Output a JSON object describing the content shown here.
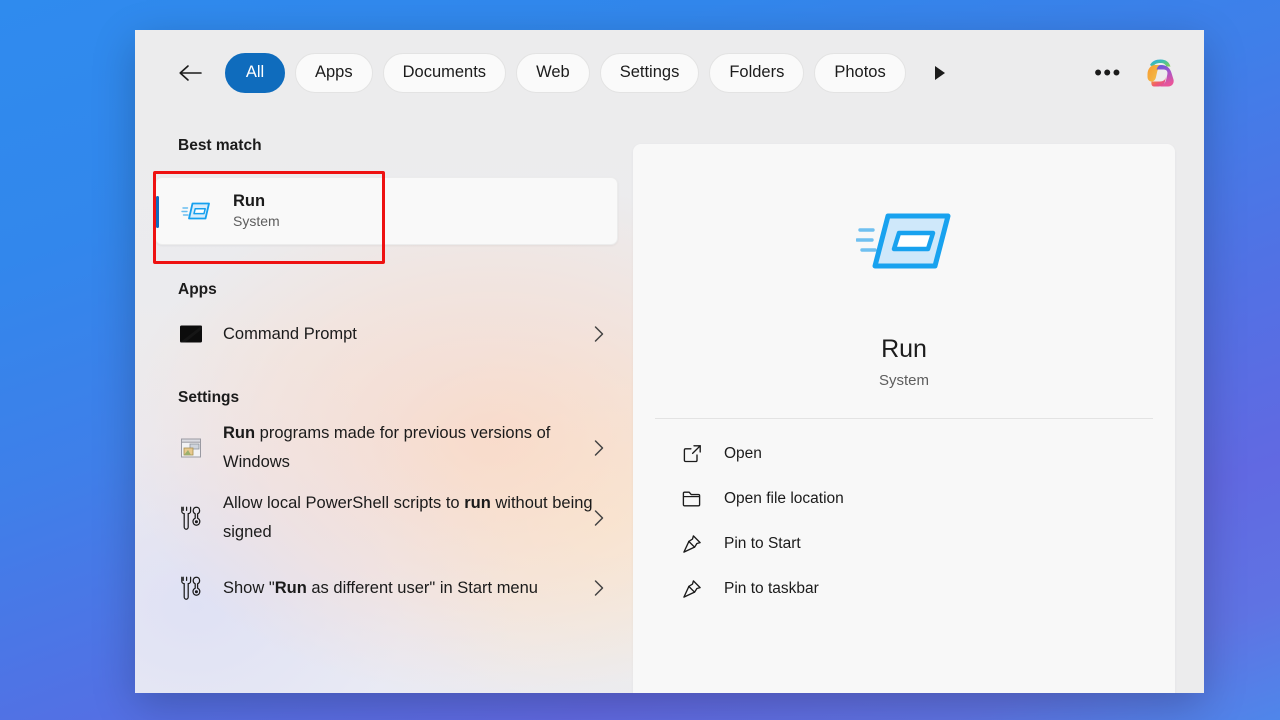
{
  "header": {
    "back_icon": "arrow-left-icon",
    "overflow_icon": "play-triangle-icon",
    "more_label": "•••",
    "copilot_icon": "copilot-icon",
    "filters": [
      {
        "label": "All",
        "active": true
      },
      {
        "label": "Apps",
        "active": false
      },
      {
        "label": "Documents",
        "active": false
      },
      {
        "label": "Web",
        "active": false
      },
      {
        "label": "Settings",
        "active": false
      },
      {
        "label": "Folders",
        "active": false
      },
      {
        "label": "Photos",
        "active": false
      }
    ]
  },
  "left": {
    "best_match_label": "Best match",
    "best_match": {
      "title": "Run",
      "subtitle": "System",
      "icon": "run-app-icon"
    },
    "apps_label": "Apps",
    "apps": [
      {
        "text": "Command Prompt",
        "icon": "command-prompt-icon",
        "chevron": "chevron-right-icon"
      }
    ],
    "settings_label": "Settings",
    "settings": [
      {
        "html": "<b>Run</b> programs made for previous versions of Windows",
        "icon": "program-compatibility-icon",
        "chevron": "chevron-right-icon"
      },
      {
        "html": "Allow local PowerShell scripts to <b>run</b> without being signed",
        "icon": "tools-icon",
        "chevron": "chevron-right-icon"
      },
      {
        "html": "Show \"<b>Run</b> as different user\" in Start menu",
        "icon": "tools-icon",
        "chevron": "chevron-right-icon"
      }
    ]
  },
  "preview": {
    "icon": "run-app-icon-large",
    "title": "Run",
    "subtitle": "System",
    "actions": [
      {
        "label": "Open",
        "icon": "external-link-icon"
      },
      {
        "label": "Open file location",
        "icon": "folder-icon"
      },
      {
        "label": "Pin to Start",
        "icon": "pin-icon"
      },
      {
        "label": "Pin to taskbar",
        "icon": "pin-icon"
      }
    ]
  },
  "colors": {
    "accent": "#0f6cbd",
    "highlight_box": "#ee1111",
    "window_bg": "#ececed",
    "card_bg": "#f8f8f8",
    "desktop_start": "#2f8bee",
    "desktop_end": "#6169e2"
  }
}
